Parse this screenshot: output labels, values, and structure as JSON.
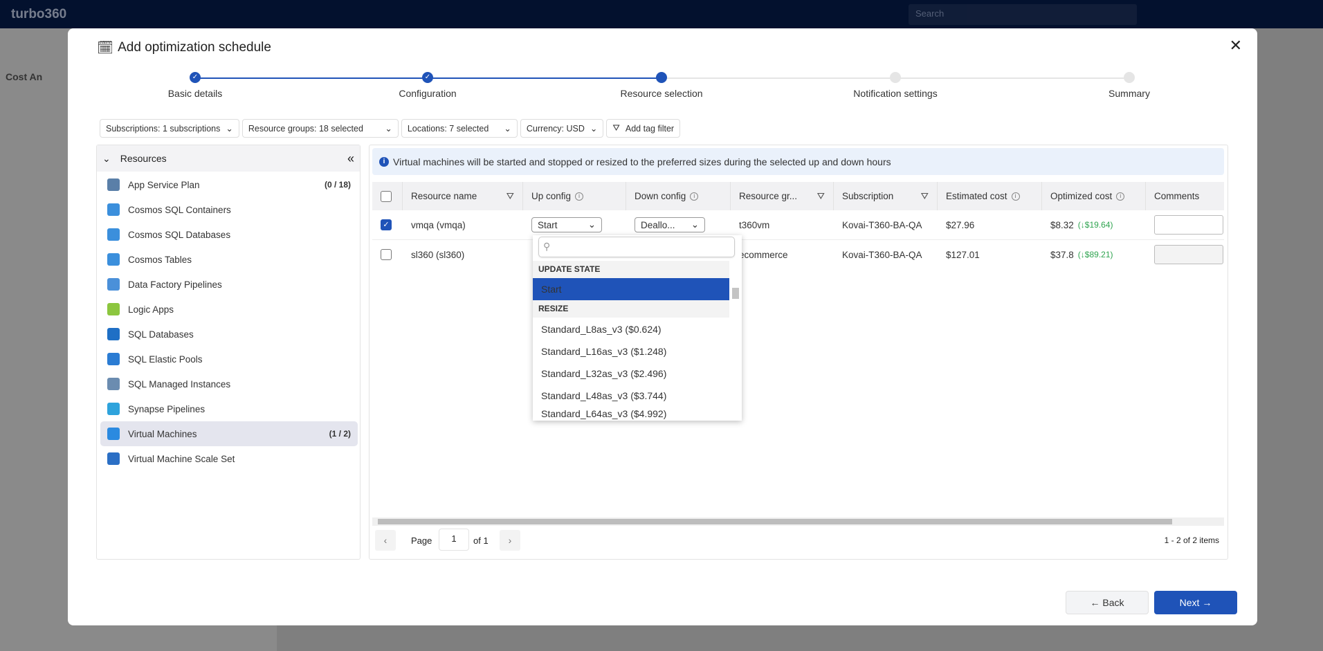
{
  "app": {
    "name": "turbo360",
    "search_placeholder": "Search",
    "bg_title": "Cost An"
  },
  "modal": {
    "title": "Add optimization schedule"
  },
  "stepper": [
    {
      "label": "Basic details",
      "state": "done"
    },
    {
      "label": "Configuration",
      "state": "done"
    },
    {
      "label": "Resource selection",
      "state": "active"
    },
    {
      "label": "Notification settings",
      "state": "pending"
    },
    {
      "label": "Summary",
      "state": "pending"
    }
  ],
  "filters": [
    {
      "label": "Subscriptions: 1 subscriptions"
    },
    {
      "label": "Resource groups: 18 selected"
    },
    {
      "label": "Locations: 7 selected"
    },
    {
      "label": "Currency: USD"
    },
    {
      "label": "Add tag filter"
    }
  ],
  "resources": {
    "header": "Resources",
    "items": [
      {
        "label": "App Service Plan",
        "count": "(0 / 18)",
        "icon": "app-service-plan-icon",
        "color": "#5a7fa8"
      },
      {
        "label": "Cosmos SQL Containers",
        "icon": "cosmos-icon",
        "color": "#3b8fdc"
      },
      {
        "label": "Cosmos SQL Databases",
        "icon": "cosmos-icon",
        "color": "#3b8fdc"
      },
      {
        "label": "Cosmos Tables",
        "icon": "cosmos-icon",
        "color": "#3b8fdc"
      },
      {
        "label": "Data Factory Pipelines",
        "icon": "data-factory-icon",
        "color": "#4a90d9"
      },
      {
        "label": "Logic Apps",
        "icon": "logic-apps-icon",
        "color": "#8cc63f"
      },
      {
        "label": "SQL Databases",
        "icon": "sql-database-icon",
        "color": "#1f6fc5"
      },
      {
        "label": "SQL Elastic Pools",
        "icon": "sql-elastic-pool-icon",
        "color": "#2b7cd3"
      },
      {
        "label": "SQL Managed Instances",
        "icon": "sql-managed-instance-icon",
        "color": "#6b8cb0"
      },
      {
        "label": "Synapse Pipelines",
        "icon": "synapse-icon",
        "color": "#2ea3dc"
      },
      {
        "label": "Virtual Machines",
        "count": "(1 / 2)",
        "icon": "virtual-machine-icon",
        "color": "#2b8ae0",
        "selected": true
      },
      {
        "label": "Virtual Machine Scale Set",
        "icon": "vmss-icon",
        "color": "#2b6fc5"
      }
    ]
  },
  "info": "Virtual machines will be started and stopped or resized to the preferred sizes during the selected up and down hours",
  "table": {
    "columns": [
      "Resource name",
      "Up config",
      "Down config",
      "Resource gr...",
      "Subscription",
      "Estimated cost",
      "Optimized cost",
      "Comments"
    ],
    "rows": [
      {
        "checked": true,
        "name": "vmqa (vmqa)",
        "up": "Start",
        "down": "Deallo...",
        "group": "t360vm",
        "subscription": "Kovai-T360-BA-QA",
        "estimated": "$27.96",
        "optimized": "$8.32",
        "saving": "(↓$19.64)"
      },
      {
        "checked": false,
        "name": "sl360 (sl360)",
        "group": "ecommerce",
        "subscription": "Kovai-T360-BA-QA",
        "estimated": "$127.01",
        "optimized": "$37.8",
        "saving": "(↓$89.21)"
      }
    ]
  },
  "dropdown": {
    "search_placeholder": "",
    "groups": [
      {
        "label": "UPDATE STATE",
        "options": [
          "Start"
        ]
      },
      {
        "label": "RESIZE",
        "options": [
          "Standard_L8as_v3 ($0.624)",
          "Standard_L16as_v3 ($1.248)",
          "Standard_L32as_v3 ($2.496)",
          "Standard_L48as_v3 ($3.744)",
          "Standard_L64as_v3 ($4.992)"
        ]
      }
    ],
    "selected": "Start"
  },
  "pagination": {
    "page_label": "Page",
    "page": "1",
    "of_label": "of 1",
    "summary": "1 - 2 of 2 items"
  },
  "footer": {
    "back": "← Back",
    "next": "Next →"
  },
  "colors": {
    "primary": "#1f53b8",
    "saving": "#2ea44f"
  }
}
